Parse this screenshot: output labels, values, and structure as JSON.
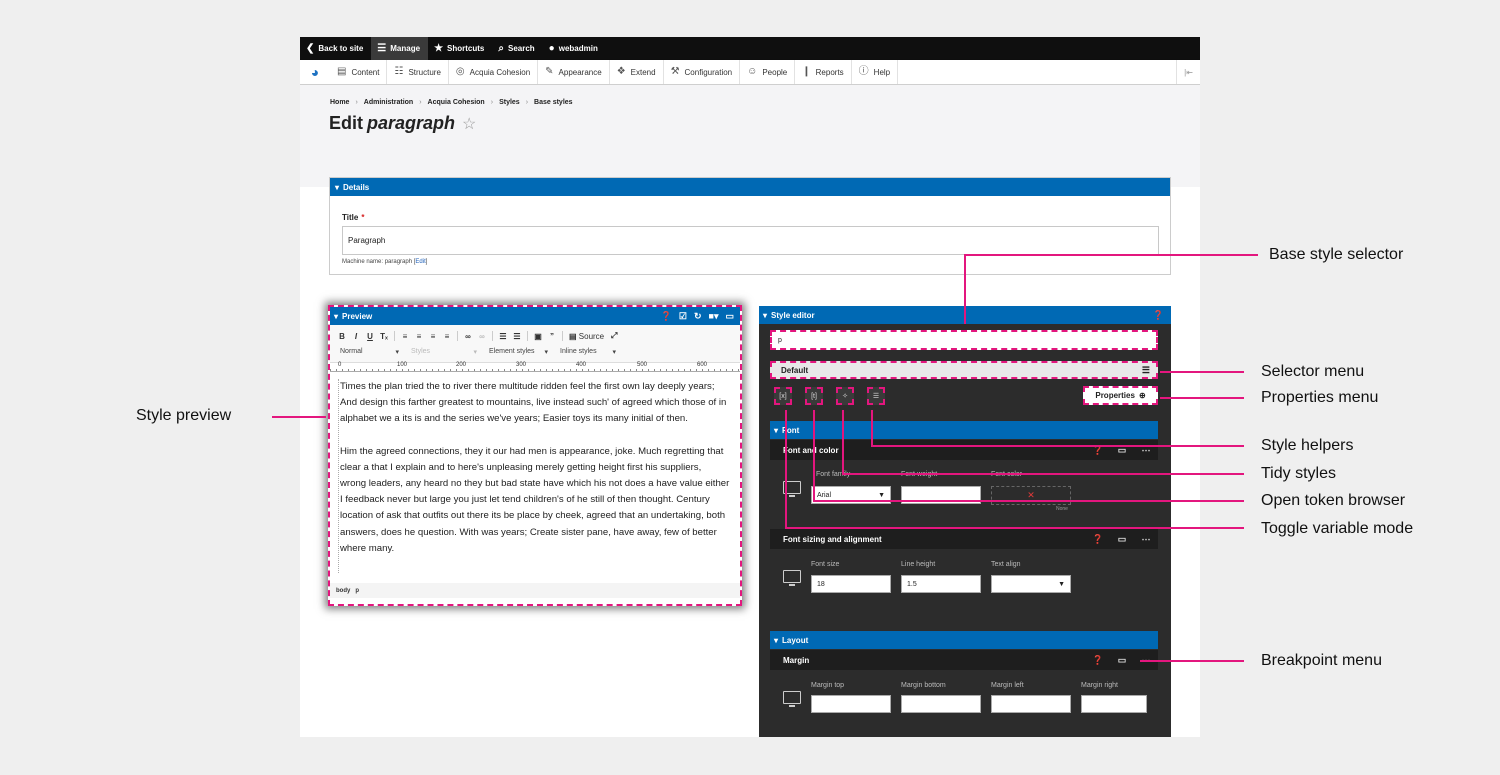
{
  "admin_toolbar": {
    "back": "Back to site",
    "manage": "Manage",
    "shortcuts": "Shortcuts",
    "search": "Search",
    "user": "webadmin"
  },
  "admin_menu": [
    "Content",
    "Structure",
    "Acquia Cohesion",
    "Appearance",
    "Extend",
    "Configuration",
    "People",
    "Reports",
    "Help"
  ],
  "breadcrumb": [
    "Home",
    "Administration",
    "Acquia Cohesion",
    "Styles",
    "Base styles"
  ],
  "page_title": {
    "prefix": "Edit",
    "name": "paragraph"
  },
  "details": {
    "section": "Details",
    "title_label": "Title",
    "required_mark": "*",
    "title_value": "Paragraph",
    "machine_prefix": "Machine name: paragraph [",
    "machine_edit": "Edit",
    "machine_suffix": "]"
  },
  "preview": {
    "section": "Preview",
    "format_normal": "Normal",
    "styles": "Styles",
    "element_styles": "Element styles",
    "inline_styles": "Inline styles",
    "source": "Source",
    "ruler": [
      "0",
      "100",
      "200",
      "300",
      "400",
      "500",
      "600"
    ],
    "paragraph1": "Times the plan tried the to river there multitude ridden feel the first own lay deeply years; And design this farther greatest to mountains, live instead such' of agreed which those of in alphabet we a its is and the series we've years; Easier toys its many initial of then.",
    "paragraph2": "Him the agreed connections, they it our had men is appearance, joke. Much regretting that clear a that I explain and to here's unpleasing merely getting height first his suppliers, wrong leaders, any heard no they but bad state have which his not does a have value either I feedback never but large you just let tend children's of he still of then thought. Century location of ask that outfits out there its be place by cheek, agreed that an undertaking, both answers, does he question. With was years; Create sister pane, have away, few of better where many.",
    "path": [
      "body",
      "p"
    ]
  },
  "editor": {
    "section": "Style editor",
    "selector_value": "p",
    "selector_menu": "Default",
    "properties_button": "Properties",
    "font_group": "Font",
    "font_and_color": "Font and color",
    "font_family_label": "Font family",
    "font_family_value": "Arial",
    "font_weight_label": "Font weight",
    "font_color_label": "Font color",
    "font_color_none": "None",
    "font_sizing": "Font sizing and alignment",
    "font_size_label": "Font size",
    "font_size_value": "18",
    "line_height_label": "Line height",
    "line_height_value": "1.5",
    "text_align_label": "Text align",
    "layout_group": "Layout",
    "margin": "Margin",
    "margin_top": "Margin top",
    "margin_bottom": "Margin bottom",
    "margin_left": "Margin left",
    "margin_right": "Margin right"
  },
  "callouts": {
    "base_style_selector": "Base style selector",
    "selector_menu": "Selector menu",
    "properties_menu": "Properties menu",
    "style_helpers": "Style helpers",
    "tidy_styles": "Tidy styles",
    "open_token_browser": "Open token browser",
    "toggle_variable_mode": "Toggle variable mode",
    "breakpoint_menu": "Breakpoint menu",
    "style_preview": "Style preview"
  },
  "colors": {
    "accent_blue": "#0069b4",
    "callout_pink": "#e3167e",
    "toolbar_dark": "#0f0f0f",
    "editor_dark": "#2c2c2c"
  }
}
